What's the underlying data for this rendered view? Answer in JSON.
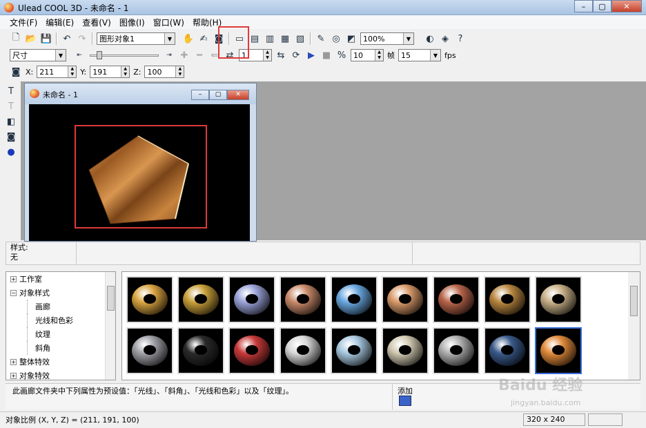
{
  "window": {
    "title": "Ulead COOL 3D - 未命名 - 1",
    "min": "–",
    "max": "▢",
    "close": "✕"
  },
  "menu": [
    "文件(F)",
    "编辑(E)",
    "查看(V)",
    "图像(I)",
    "窗口(W)",
    "帮助(H)"
  ],
  "toolbar1": {
    "object_select": "图形对象1",
    "zoom": "100%"
  },
  "toolbar2": {
    "mode_select": "尺寸",
    "frame_value": "1",
    "fps_value1": "10",
    "frame_label": "帧",
    "fps_value2": "15",
    "fps_label": "fps"
  },
  "toolbar3": {
    "x_label": "X:",
    "x_value": "211",
    "y_label": "Y:",
    "y_value": "191",
    "z_label": "Z:",
    "z_value": "100"
  },
  "document": {
    "title": "未命名 - 1",
    "min": "–",
    "max": "▢",
    "close": "✕"
  },
  "style_panel": {
    "label": "样式:",
    "value": "无"
  },
  "tree": {
    "items": [
      {
        "label": "工作室",
        "expand": "+"
      },
      {
        "label": "对象样式",
        "expand": "−"
      },
      {
        "label": "画廊"
      },
      {
        "label": "光线和色彩"
      },
      {
        "label": "纹理"
      },
      {
        "label": "斜角"
      },
      {
        "label": "整体特效",
        "expand": "+"
      },
      {
        "label": "对象特效",
        "expand": "+"
      }
    ]
  },
  "thumbnails": {
    "colors": [
      "#d9a441",
      "#c9a03a",
      "#9aa3d8",
      "#c98a6a",
      "#6aa8e0",
      "#d99a6a",
      "#b8654a",
      "#b88640",
      "#c8b088",
      "#a0a0a8",
      "#2a2a2a",
      "#c83a3a",
      "#d8d8d8",
      "#a8c8e0",
      "#d0c8b0",
      "#b0b0b0",
      "#3a5a8a",
      "#e08a3a"
    ]
  },
  "description": {
    "text": "此画廊文件夹中下列属性为预设值：「光线」、「斜角」、「光线和色彩」以及「纹理」。",
    "add_label": "添加"
  },
  "status": {
    "left": "对象比例 (X, Y, Z) = (211, 191, 100)",
    "size": "320 x 240"
  },
  "watermark": {
    "main": "Baidu 经验",
    "sub": "jingyan.baidu.com"
  }
}
